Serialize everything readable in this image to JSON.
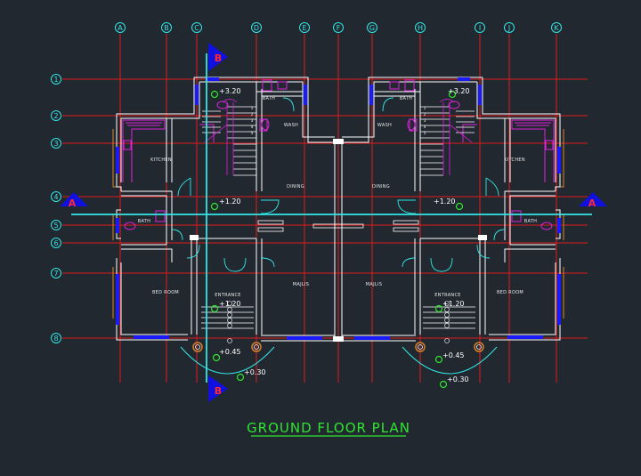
{
  "title": "GROUND FLOOR PLAN",
  "grid_columns": [
    "A",
    "B",
    "C",
    "D",
    "E",
    "F",
    "G",
    "H",
    "I",
    "J",
    "K"
  ],
  "grid_rows": [
    "1",
    "2",
    "3",
    "4",
    "5",
    "6",
    "7",
    "8"
  ],
  "rooms": {
    "kitchen": "KITCHEN",
    "bath": "BATH",
    "wash": "WASH",
    "dining": "DINING",
    "majlis": "MAJLIS",
    "entrance": "ENTRANCE",
    "bedroom": "BED ROOM"
  },
  "levels": {
    "roof": "+3.20",
    "floor": "+1.20",
    "step": "+0.45",
    "ground": "+0.30"
  },
  "sections": {
    "a": "A",
    "b": "B"
  },
  "stair_steps": [
    "1",
    "2",
    "3",
    "4",
    "5",
    "6",
    "7",
    "8",
    "9",
    "10"
  ],
  "colors": {
    "background": "#212830",
    "grid": "#e01b1b",
    "walls": "#ffffff",
    "windows": "#1a1aff",
    "section": "#1010e0",
    "cyan": "#33e6e6",
    "magenta": "#e020e0",
    "title": "#2ee62e"
  }
}
